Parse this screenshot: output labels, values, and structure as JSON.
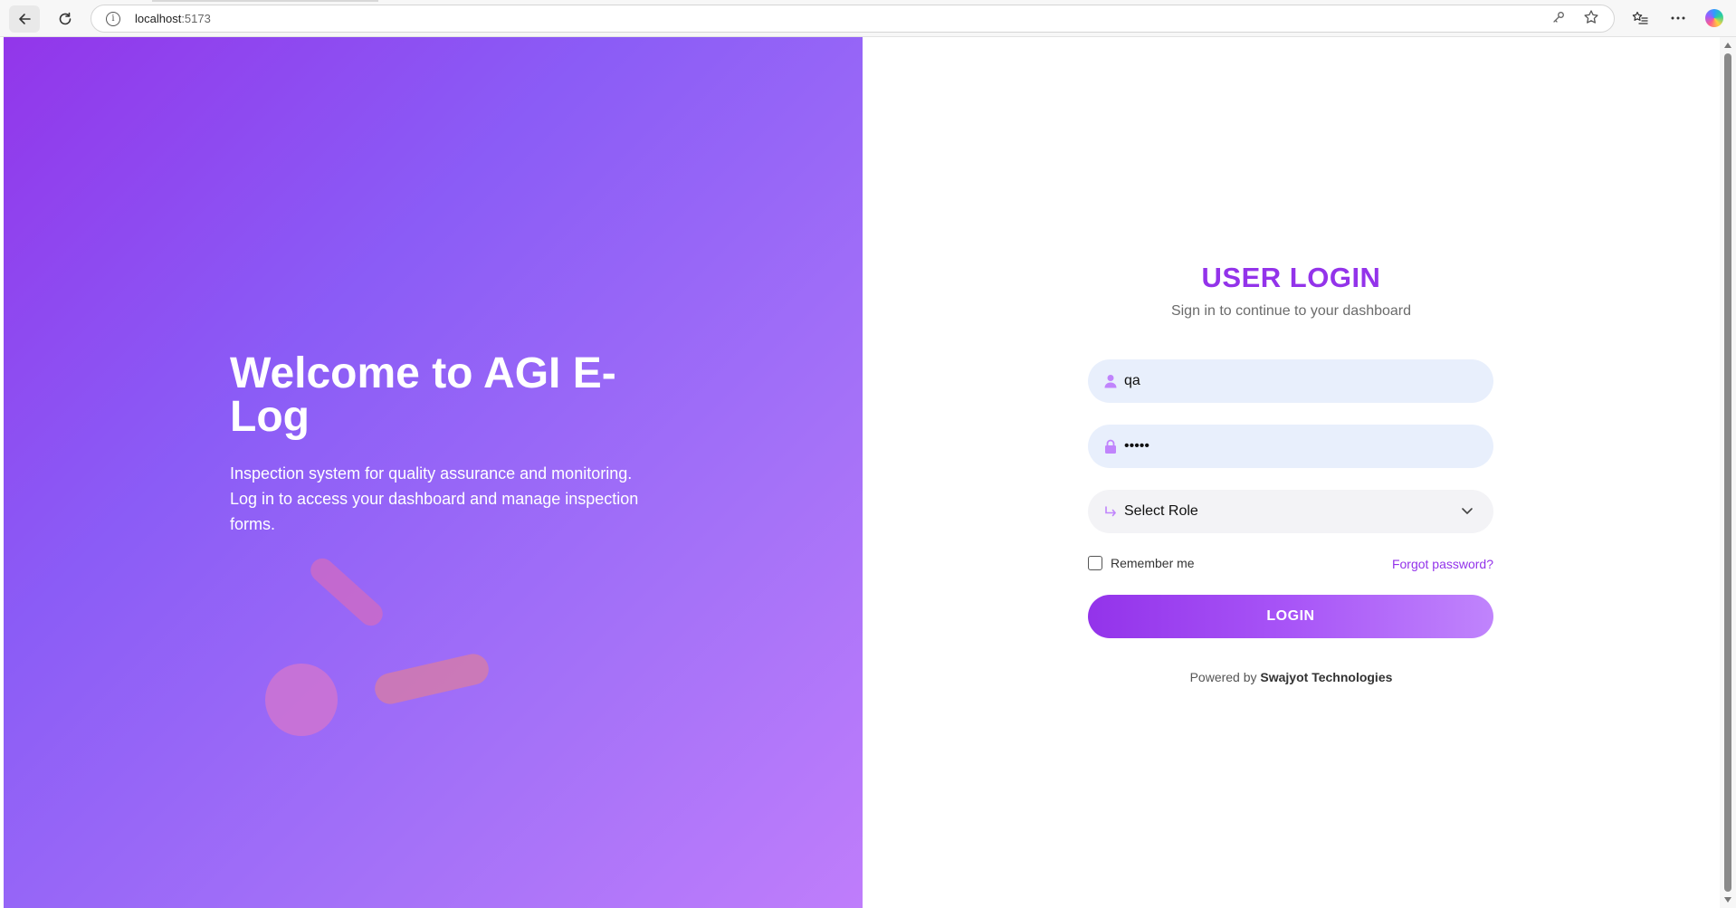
{
  "browser": {
    "url_host": "localhost",
    "url_port": ":5173"
  },
  "hero": {
    "title": "Welcome to AGI E-Log",
    "description": "Inspection system for quality assurance and monitoring. Log in to access your dashboard and manage inspection forms."
  },
  "login": {
    "title": "USER LOGIN",
    "subtitle": "Sign in to continue to your dashboard",
    "username_value": "qa",
    "password_value": "•••••",
    "role_selected": "Select Role",
    "remember_label": "Remember me",
    "forgot_label": "Forgot password?",
    "button_label": "LOGIN",
    "powered_prefix": "Powered by",
    "powered_company": "Swajyot Technologies"
  },
  "colors": {
    "accent": "#9333ea",
    "input_bg": "#e8effc",
    "gradient_start": "#9236ea",
    "gradient_end": "#bf7dfb"
  }
}
